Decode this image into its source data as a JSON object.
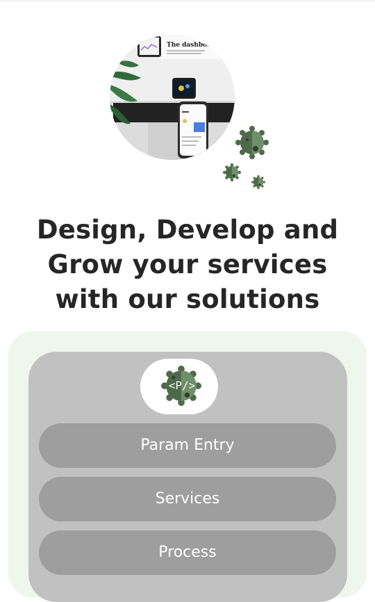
{
  "headline": {
    "line1": "Design, Develop and",
    "line2": "Grow your services",
    "line3": "with our solutions"
  },
  "hero": {
    "screen_title": "The dashboard"
  },
  "logo": {
    "text": "<P/>"
  },
  "menu": {
    "items": [
      {
        "label": "Param Entry"
      },
      {
        "label": "Services"
      },
      {
        "label": "Process"
      }
    ]
  },
  "colors": {
    "card_background": "#eff7ec",
    "inner_panel": "#c1c1c1",
    "button": "#9e9e9e",
    "gear_dark": "#4e6a4a",
    "gear_light": "#6f8f68",
    "headline_text": "#262626"
  },
  "icons": {
    "hero_image": "desk-monitor-phone-photo",
    "decorative": "virus-gear-icon"
  }
}
